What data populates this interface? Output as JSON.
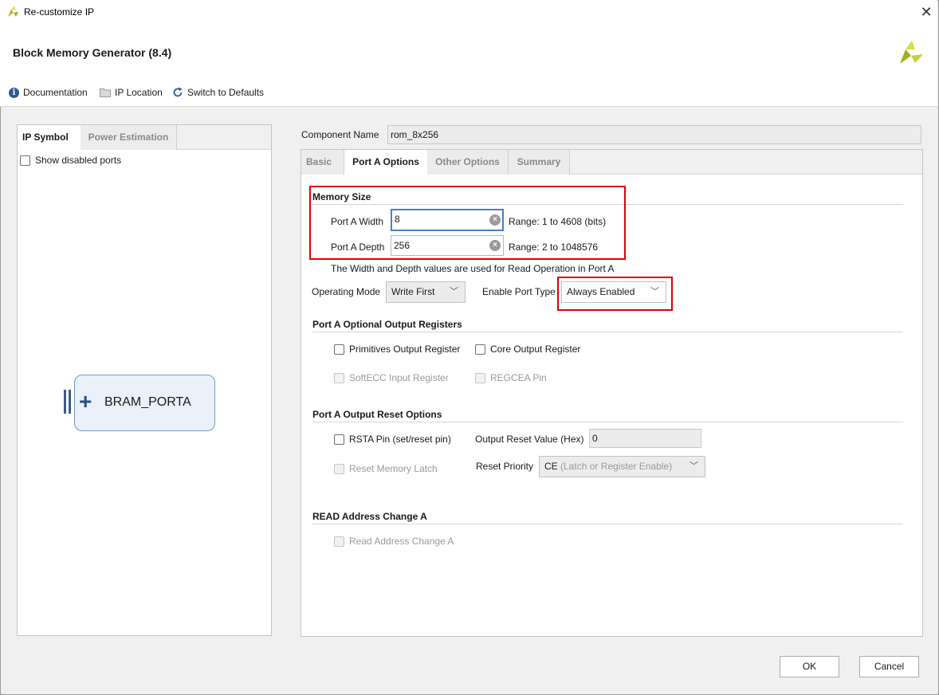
{
  "window": {
    "title": "Re-customize IP",
    "close_glyph": "✕"
  },
  "header": {
    "ip_name": "Block Memory Generator (8.4)",
    "logo_icon": "xilinx-logo",
    "toolbar": {
      "documentation": "Documentation",
      "ip_location": "IP Location",
      "switch_defaults": "Switch to Defaults"
    }
  },
  "left_panel": {
    "tabs": [
      "IP Symbol",
      "Power Estimation"
    ],
    "active_tab": "IP Symbol",
    "show_disabled_ports": "Show disabled ports",
    "symbol": {
      "plus": "+",
      "port_name": "BRAM_PORTA"
    }
  },
  "component": {
    "label": "Component Name",
    "value": "rom_8x256"
  },
  "right_tabs": [
    "Basic",
    "Port A Options",
    "Other Options",
    "Summary"
  ],
  "right_active_tab": "Port A Options",
  "memory_size": {
    "title": "Memory Size",
    "width_label": "Port A Width",
    "width_value": "8",
    "width_range": "Range: 1 to 4608 (bits)",
    "depth_label": "Port A Depth",
    "depth_value": "256",
    "depth_range": "Range: 2 to 1048576",
    "note": "The Width and Depth values are used for Read Operation in Port A"
  },
  "operating_mode": {
    "label": "Operating Mode",
    "value": "Write First"
  },
  "enable_port_type": {
    "label": "Enable Port Type",
    "value": "Always Enabled"
  },
  "optional_output_registers": {
    "title": "Port A Optional Output Registers",
    "primitives": "Primitives Output Register",
    "core": "Core Output Register",
    "softecc": "SoftECC Input Register",
    "regcea": "REGCEA Pin"
  },
  "output_reset": {
    "title": "Port A Output Reset Options",
    "rsta": "RSTA Pin (set/reset pin)",
    "reset_value_label": "Output Reset Value (Hex)",
    "reset_value": "0",
    "reset_memory_latch": "Reset Memory Latch",
    "reset_priority_label": "Reset Priority",
    "reset_priority_code": "CE",
    "reset_priority_desc": "(Latch or Register Enable)"
  },
  "read_address": {
    "title": "READ Address Change A",
    "checkbox": "Read Address Change A"
  },
  "buttons": {
    "ok": "OK",
    "cancel": "Cancel"
  },
  "colors": {
    "highlight": "#e00000",
    "focus": "#4a7fc9",
    "logo": "#c8cc3a"
  }
}
